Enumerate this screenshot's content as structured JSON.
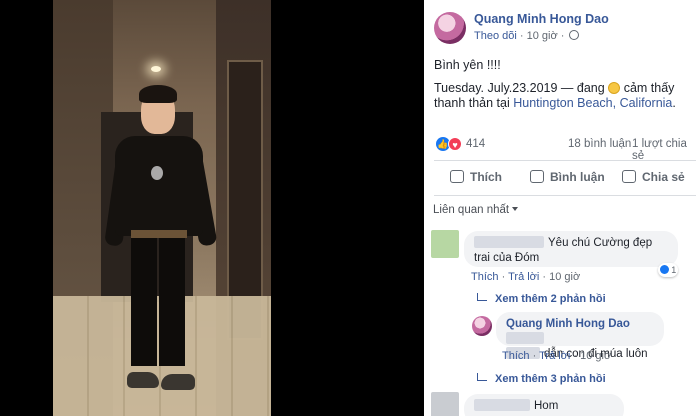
{
  "post": {
    "author": "Quang Minh Hong Dao",
    "follow_label": "Theo dõi",
    "separator": "·",
    "time": "10 giờ",
    "line1": "Bình yên !!!!",
    "line2_prefix": "Tuesday. July.23.2019 — đang",
    "line2_feeling": "cảm thấy thanh thản tại",
    "location": "Huntington Beach, California",
    "end_punct": "."
  },
  "stats": {
    "reaction_count": "414",
    "comments": "18 bình luận",
    "shares": "1 lượt chia sẻ"
  },
  "actions": {
    "like": "Thích",
    "comment": "Bình luận",
    "share": "Chia sẻ"
  },
  "sort_label": "Liên quan nhất",
  "comments": [
    {
      "text": "Yêu chú Cường đẹp trai của Đóm",
      "like_label": "Thích",
      "reply_label": "Trả lời",
      "time": "10 giờ",
      "reaction_count": "1",
      "more_replies": "Xem thêm 2 phản hồi",
      "reply": {
        "author": "Quang Minh Hong Dao",
        "text": "dẫn con đi múa luôn",
        "like_label": "Thích",
        "reply_label": "Trả lời",
        "time": "10 giờ"
      },
      "more_replies_2": "Xem thêm 3 phản hồi"
    },
    {
      "text_start": "Hom"
    }
  ],
  "colors": {
    "link": "#385898",
    "like_blue": "#1877f2",
    "love_red": "#f33e58"
  }
}
